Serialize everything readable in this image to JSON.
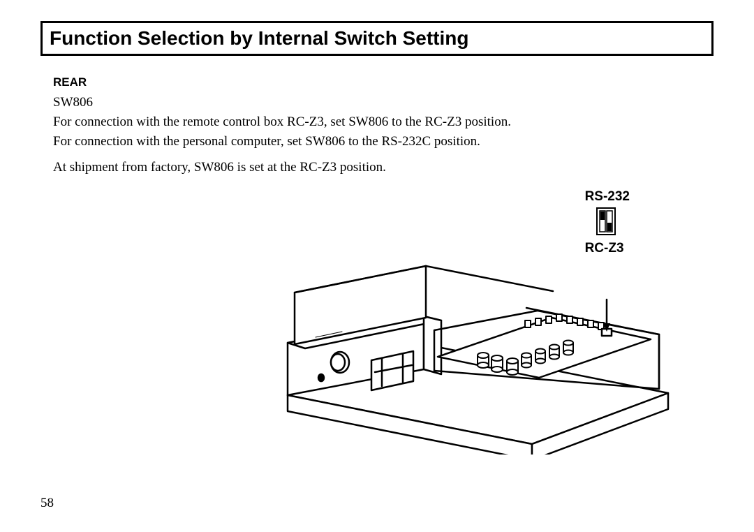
{
  "title": "Function Selection by Internal Switch Setting",
  "section_label": "REAR",
  "switch_id": "SW806",
  "paragraphs": {
    "p1": "For connection with the remote control box RC-Z3, set SW806 to the RC-Z3 position.",
    "p2": "For connection with the personal computer, set SW806 to the RS-232C position.",
    "p3": "At shipment from factory, SW806 is set at the RC-Z3 position."
  },
  "switch_labels": {
    "top": "RS-232",
    "bottom": "RC-Z3"
  },
  "page_number": "58"
}
